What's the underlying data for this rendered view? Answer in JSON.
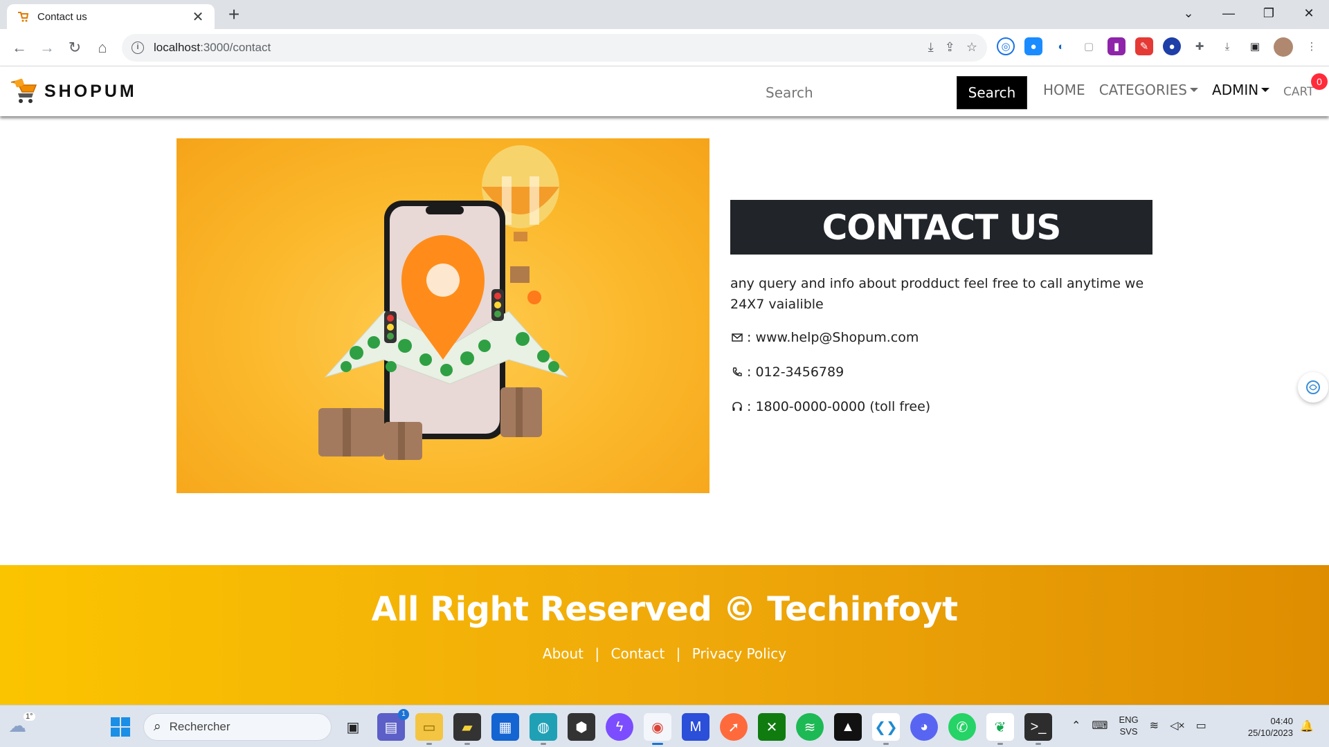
{
  "browser": {
    "tab_title": "Contact us",
    "tab_close": "✕",
    "new_tab": "+",
    "url_host": "localhost",
    "url_path": ":3000/contact",
    "window_controls": [
      "minimize",
      "maximize",
      "close"
    ]
  },
  "site": {
    "brand": "SHOPUM",
    "search_placeholder": "Search",
    "search_button": "Search",
    "nav": {
      "home": "HOME",
      "categories": "CATEGORIES",
      "admin": "ADMIN",
      "cart": "CART",
      "cart_count": "0"
    }
  },
  "contact": {
    "heading": "CONTACT US",
    "description": "any query and info about prodduct feel free to call anytime we 24X7 vaialible",
    "email": ": www.help@Shopum.com",
    "phone": ": 012-3456789",
    "toll_free": ": 1800-0000-0000 (toll free)"
  },
  "footer": {
    "copyright": "All Right Reserved © Techinfoyt",
    "links": [
      "About",
      "Contact",
      "Privacy Policy"
    ],
    "separator": "|"
  },
  "taskbar": {
    "weather_temp": "1°",
    "search_placeholder": "Rechercher",
    "chat_badge": "1",
    "lang_top": "ENG",
    "lang_bottom": "SVS",
    "time": "04:40",
    "date": "25/10/2023"
  },
  "colors": {
    "footer_gradient_start": "#fbc400",
    "footer_gradient_end": "#de8d00",
    "contact_box": "#212529",
    "cart_badge": "#ff2b3a"
  }
}
